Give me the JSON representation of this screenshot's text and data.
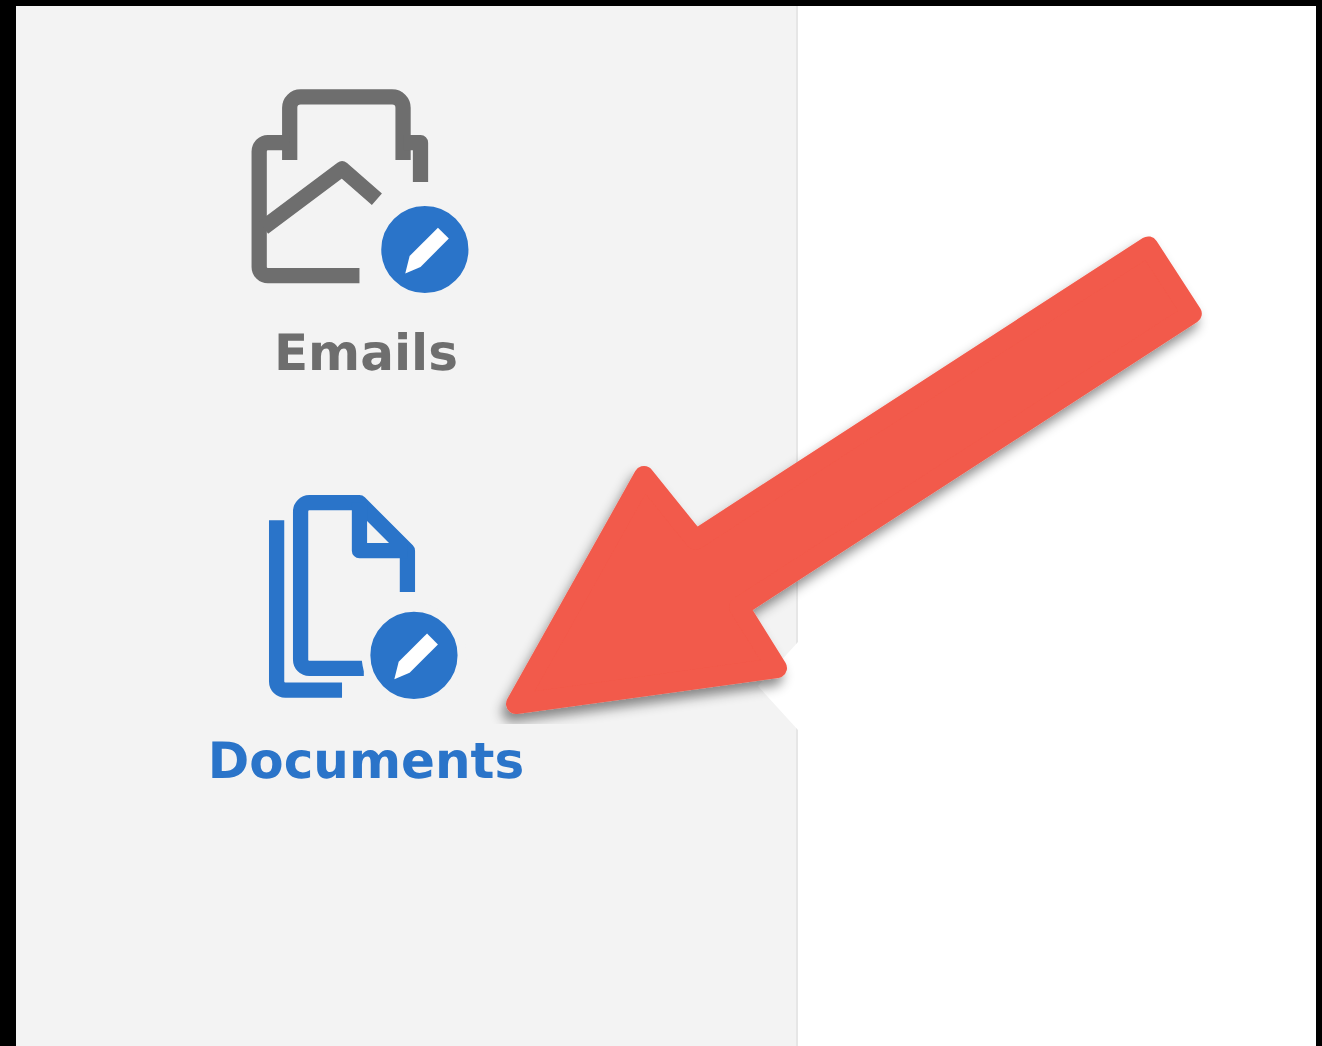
{
  "sidebar": {
    "items": [
      {
        "label": "Emails",
        "selected": false
      },
      {
        "label": "Documents",
        "selected": true
      }
    ]
  }
}
